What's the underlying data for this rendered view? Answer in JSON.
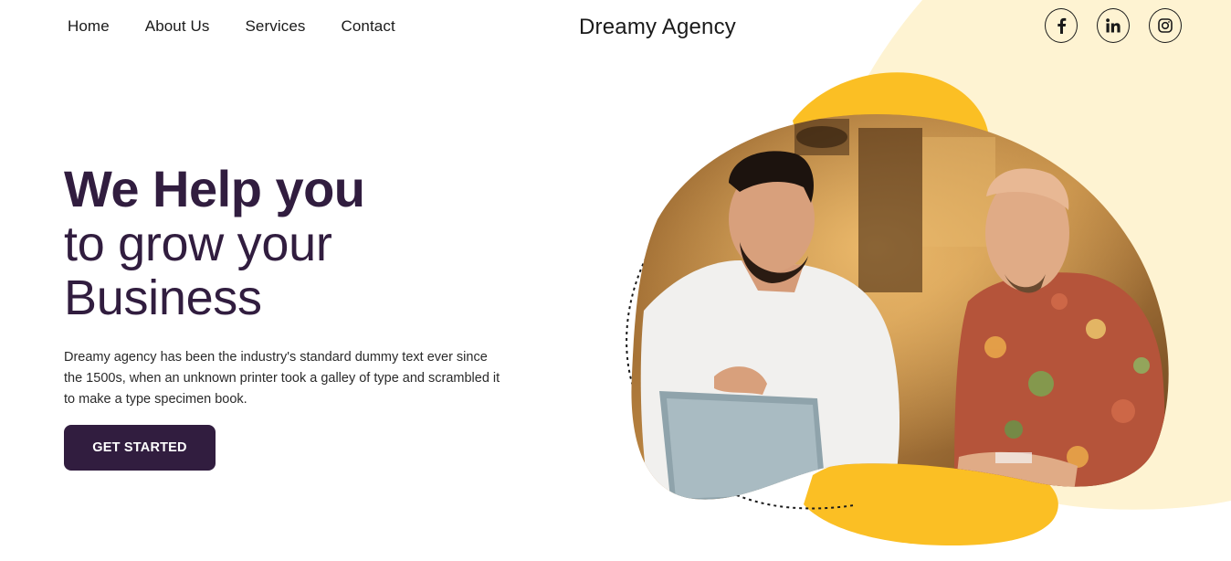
{
  "nav": {
    "items": [
      "Home",
      "About Us",
      "Services",
      "Contact"
    ]
  },
  "brand": "Dreamy Agency",
  "social": {
    "icons": [
      "facebook-icon",
      "linkedin-icon",
      "instagram-icon"
    ]
  },
  "hero": {
    "line1": "We Help you",
    "line2": "to grow your",
    "line3": "Business",
    "description": "Dreamy agency has been the industry's standard dummy text ever since the 1500s, when an unknown printer took a galley of type and scrambled it to make a type specimen book.",
    "cta_label": "GET STARTED"
  },
  "colors": {
    "primary": "#311d3f",
    "accent_yellow": "#fbbf24",
    "cream": "#fef3d2",
    "background": "#ffffff"
  }
}
